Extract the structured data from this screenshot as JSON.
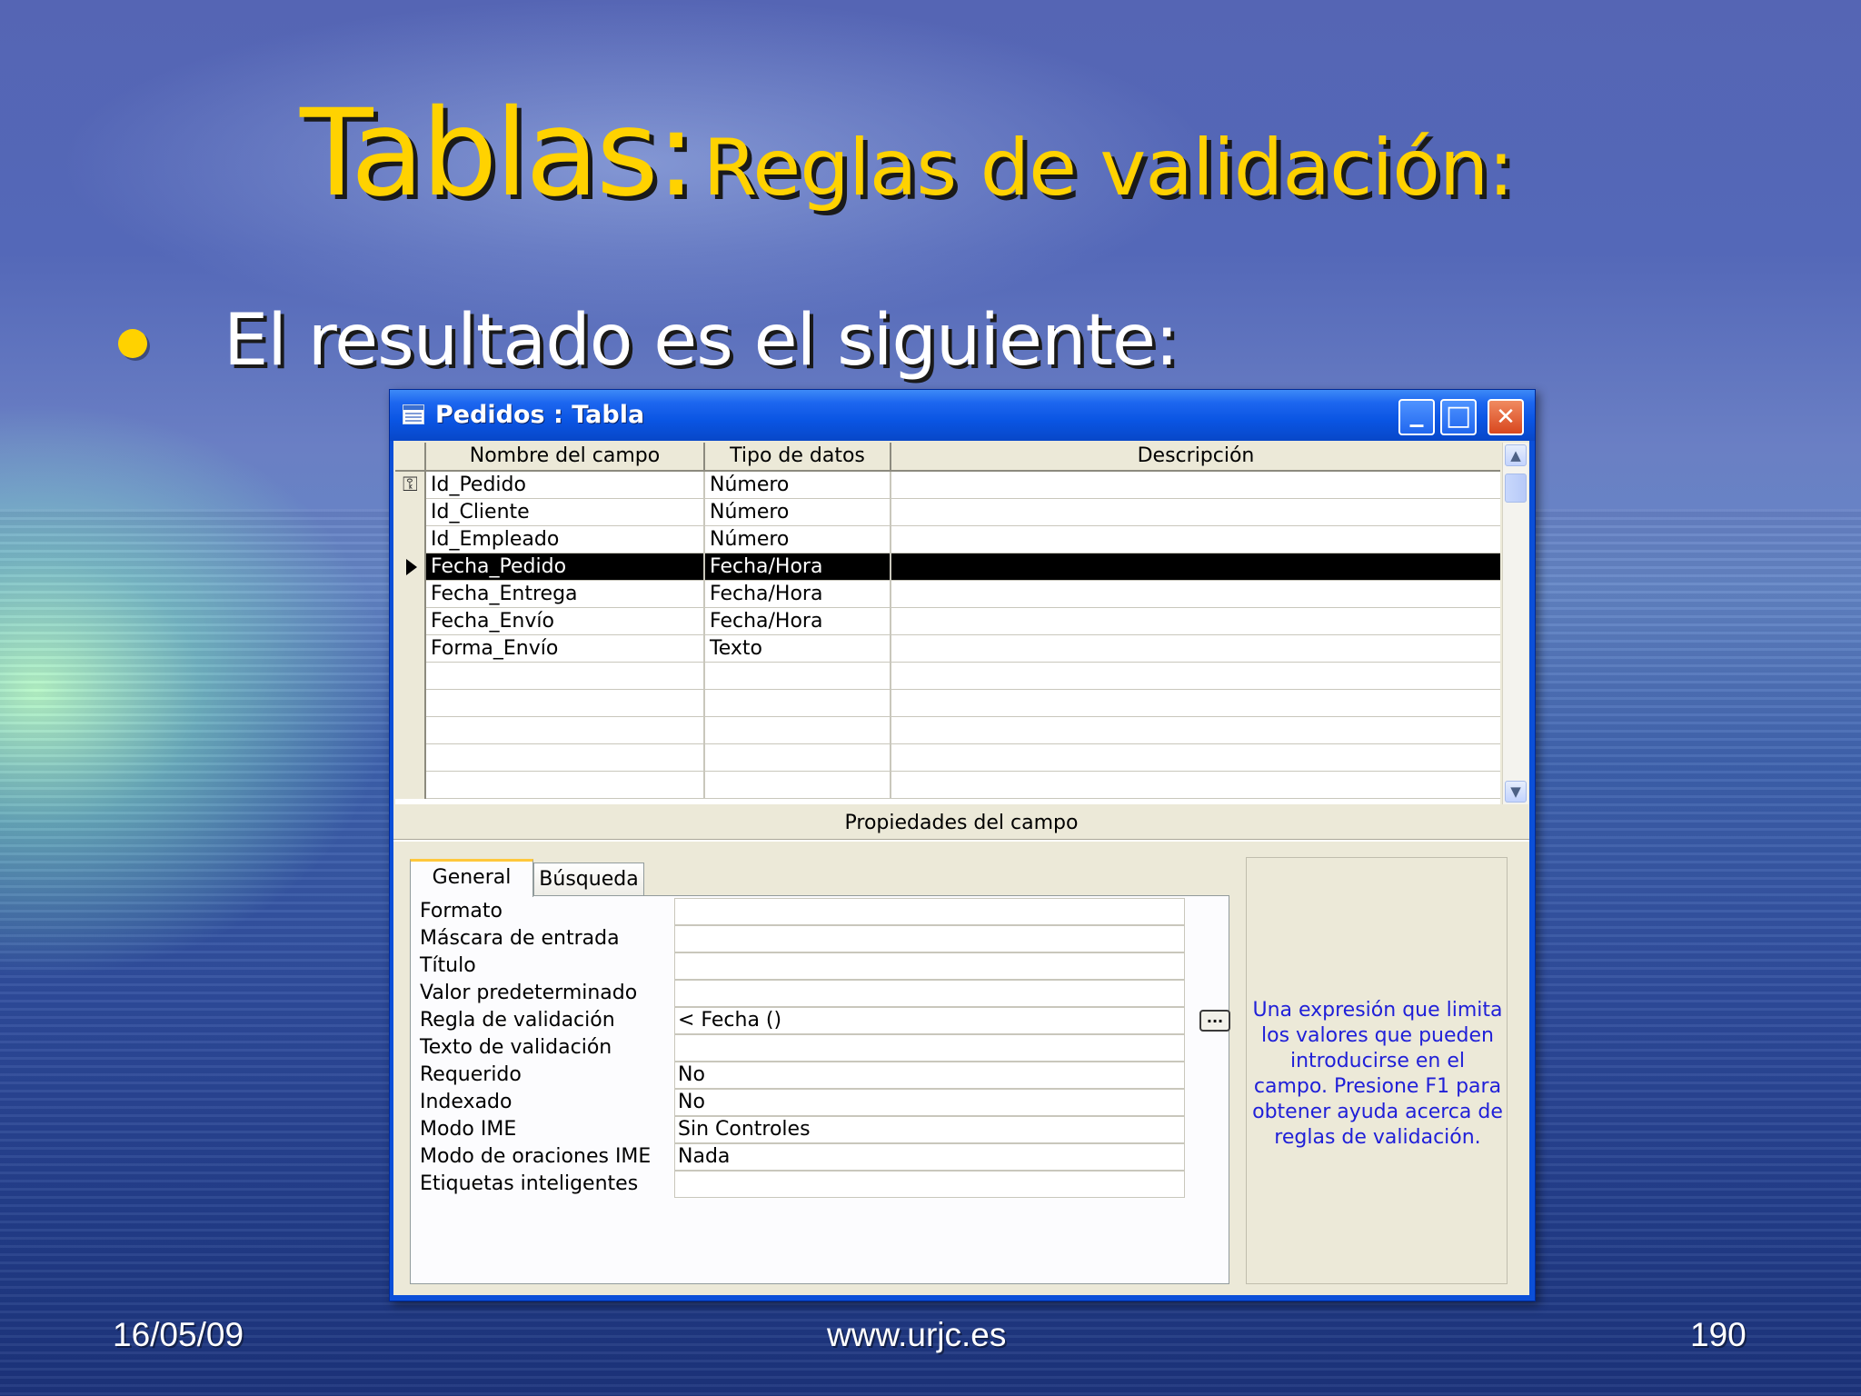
{
  "slide": {
    "title_main": "Tablas:",
    "title_sub": "Reglas de validación:",
    "bullet": "El resultado es el siguiente:",
    "footer_date": "16/05/09",
    "footer_url": "www.urjc.es",
    "footer_page": "190"
  },
  "window": {
    "title": "Pedidos : Tabla",
    "minimize_label": "_",
    "maximize_label": "□",
    "close_label": "✕"
  },
  "grid": {
    "columns": [
      "Nombre del campo",
      "Tipo de datos",
      "Descripción"
    ],
    "rows": [
      {
        "name": "Id_Pedido",
        "type": "Número",
        "desc": "",
        "indicator": "key"
      },
      {
        "name": "Id_Cliente",
        "type": "Número",
        "desc": "",
        "indicator": ""
      },
      {
        "name": "Id_Empleado",
        "type": "Número",
        "desc": "",
        "indicator": ""
      },
      {
        "name": "Fecha_Pedido",
        "type": "Fecha/Hora",
        "desc": "",
        "indicator": "current"
      },
      {
        "name": "Fecha_Entrega",
        "type": "Fecha/Hora",
        "desc": "",
        "indicator": ""
      },
      {
        "name": "Fecha_Envío",
        "type": "Fecha/Hora",
        "desc": "",
        "indicator": ""
      },
      {
        "name": "Forma_Envío",
        "type": "Texto",
        "desc": "",
        "indicator": ""
      },
      {
        "name": "",
        "type": "",
        "desc": "",
        "indicator": ""
      },
      {
        "name": "",
        "type": "",
        "desc": "",
        "indicator": ""
      },
      {
        "name": "",
        "type": "",
        "desc": "",
        "indicator": ""
      },
      {
        "name": "",
        "type": "",
        "desc": "",
        "indicator": ""
      },
      {
        "name": "",
        "type": "",
        "desc": "",
        "indicator": ""
      }
    ],
    "selected_row": 3
  },
  "properties": {
    "heading": "Propiedades del campo",
    "tabs": [
      "General",
      "Búsqueda"
    ],
    "active_tab": "General",
    "items": [
      {
        "label": "Formato",
        "value": ""
      },
      {
        "label": "Máscara de entrada",
        "value": ""
      },
      {
        "label": "Título",
        "value": ""
      },
      {
        "label": "Valor predeterminado",
        "value": ""
      },
      {
        "label": "Regla de validación",
        "value": "< Fecha ()"
      },
      {
        "label": "Texto de validación",
        "value": ""
      },
      {
        "label": "Requerido",
        "value": "No"
      },
      {
        "label": "Indexado",
        "value": "No"
      },
      {
        "label": "Modo IME",
        "value": "Sin Controles"
      },
      {
        "label": "Modo de oraciones IME",
        "value": "Nada"
      },
      {
        "label": "Etiquetas inteligentes",
        "value": ""
      }
    ],
    "build_button_label": "...",
    "help_text": "Una expresión que limita los valores que pueden introducirse en el campo. Presione F1 para obtener ayuda acerca de reglas de validación."
  },
  "colors": {
    "title_yellow": "#ffd200",
    "xp_blue": "#0a55e3",
    "help_blue": "#2020d8"
  },
  "icons": {
    "window_icon": "table-icon",
    "key_indicator": "primary-key-icon",
    "row_indicator": "current-row-arrow-icon",
    "scroll_up": "scroll-up-icon",
    "scroll_down": "scroll-down-icon"
  }
}
